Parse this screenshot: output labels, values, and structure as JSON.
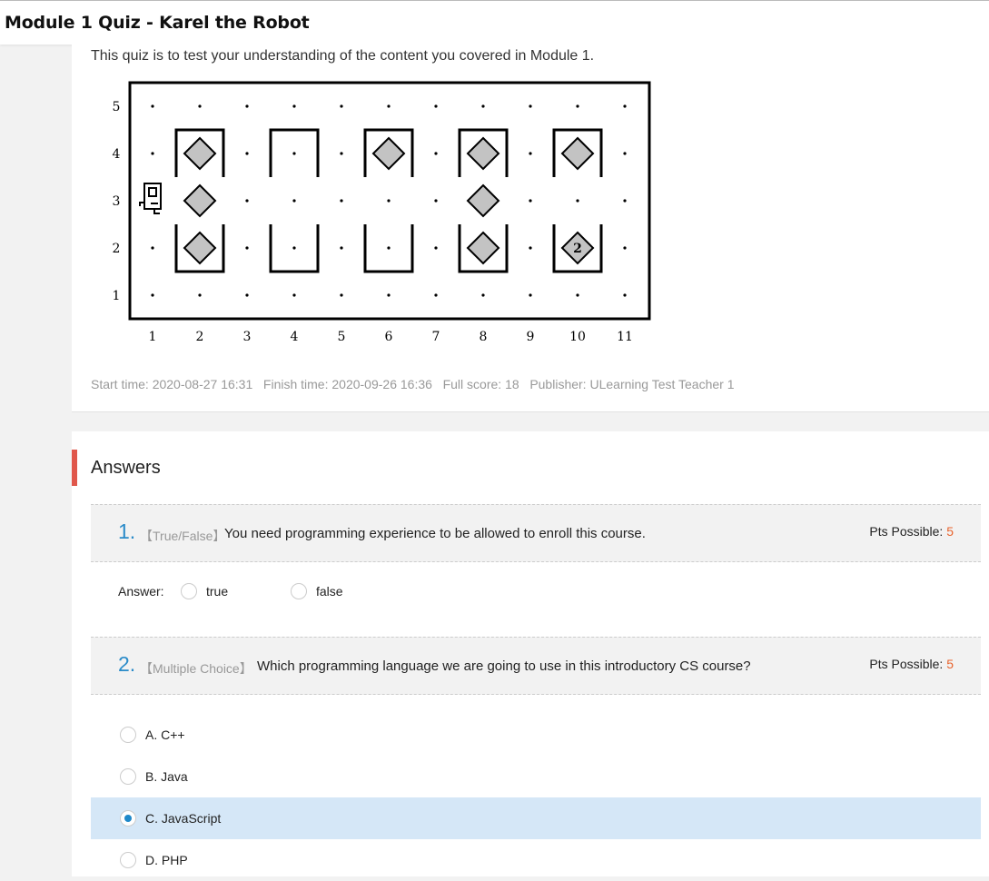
{
  "header": {
    "title": "Module 1 Quiz - Karel the Robot"
  },
  "quiz": {
    "description": "This quiz is to test your understanding of the content you covered in Module 1.",
    "meta": {
      "start_label": "Start time:",
      "start_value": "2020-08-27 16:31",
      "finish_label": "Finish time:",
      "finish_value": "2020-09-26 16:36",
      "score_label": "Full score:",
      "score_value": "18",
      "publisher_label": "Publisher:",
      "publisher_value": "ULearning Test Teacher 1"
    }
  },
  "karel_world": {
    "columns": [
      "1",
      "2",
      "3",
      "4",
      "5",
      "6",
      "7",
      "8",
      "9",
      "10",
      "11"
    ],
    "rows": [
      "1",
      "2",
      "3",
      "4",
      "5"
    ],
    "beepers": [
      {
        "col": 2,
        "row": 4,
        "count": ""
      },
      {
        "col": 2,
        "row": 3,
        "count": ""
      },
      {
        "col": 2,
        "row": 2,
        "count": ""
      },
      {
        "col": 6,
        "row": 4,
        "count": ""
      },
      {
        "col": 8,
        "row": 4,
        "count": ""
      },
      {
        "col": 8,
        "row": 3,
        "count": ""
      },
      {
        "col": 8,
        "row": 2,
        "count": ""
      },
      {
        "col": 10,
        "row": 4,
        "count": ""
      },
      {
        "col": 10,
        "row": 2,
        "count": "2"
      }
    ],
    "robot": {
      "col": 1,
      "row": 3,
      "facing": "east"
    }
  },
  "answers": {
    "title": "Answers",
    "questions": [
      {
        "number": "1.",
        "type": "【True/False】",
        "text": "You need programming experience to be allowed to enroll this course.",
        "pts_label": "Pts Possible:",
        "pts_value": "5",
        "answer_label": "Answer:",
        "options": [
          "true",
          "false"
        ]
      },
      {
        "number": "2.",
        "type": "【Multiple Choice】",
        "text": "Which programming language we are going to use in this introductory CS course?",
        "pts_label": "Pts Possible:",
        "pts_value": "5",
        "options": [
          "A. C++",
          "B. Java",
          "C. JavaScript",
          "D. PHP"
        ],
        "selected": "C. JavaScript"
      }
    ]
  }
}
